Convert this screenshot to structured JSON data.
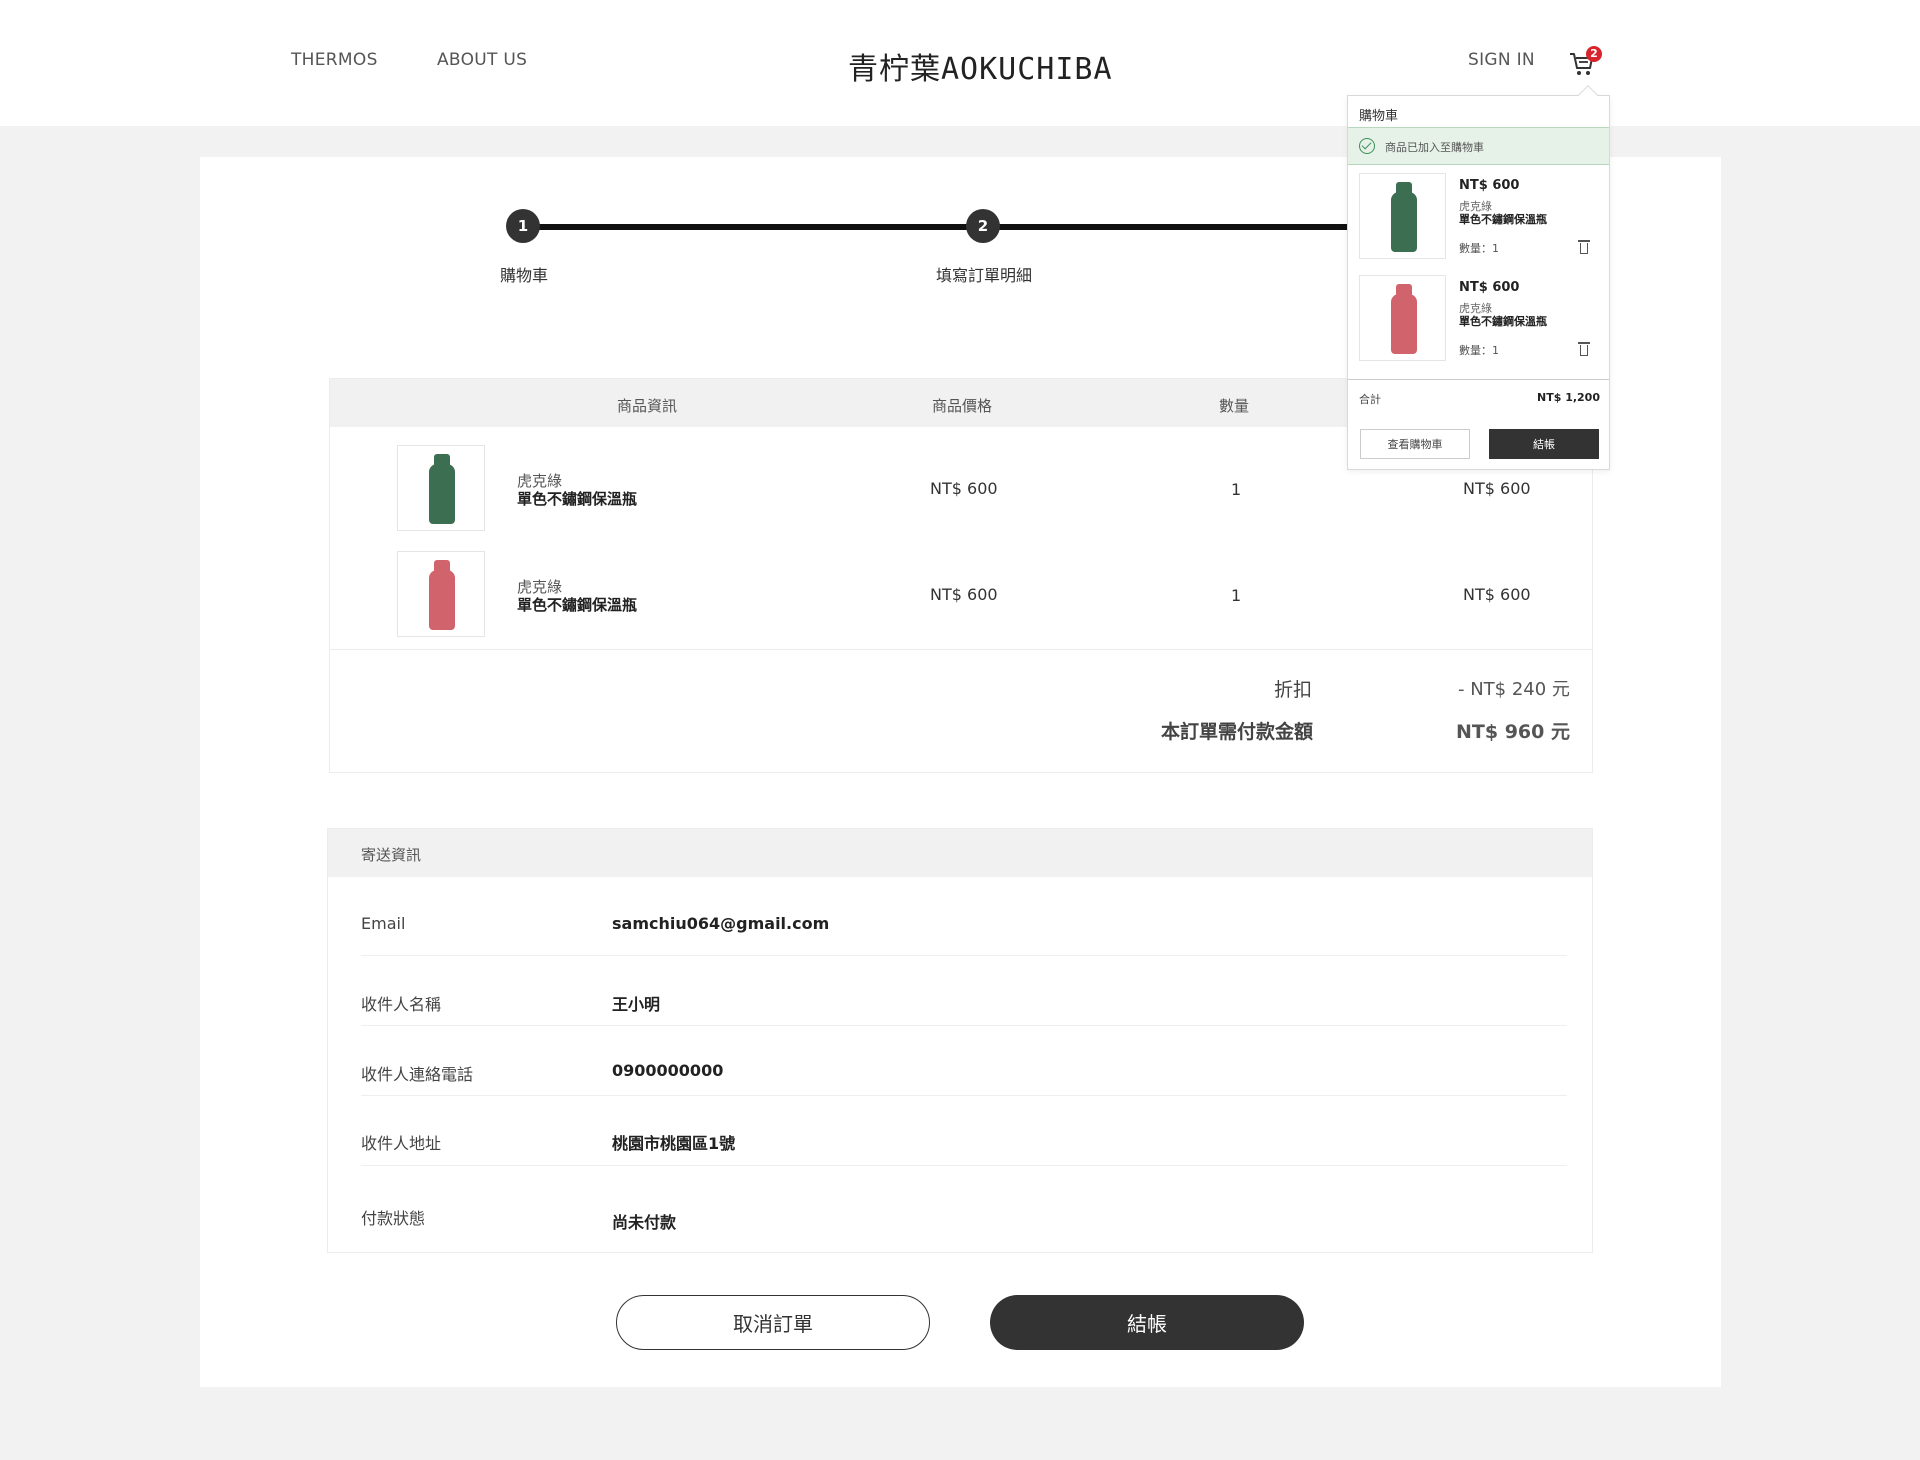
{
  "header": {
    "nav_left": [
      "THERMOS",
      "ABOUT US"
    ],
    "logo": "青柠葉AOKUCHIBA",
    "sign_in": "SIGN IN",
    "cart_count": "2"
  },
  "stepper": {
    "steps": [
      {
        "number": "1",
        "label": "購物車"
      },
      {
        "number": "2",
        "label": "填寫訂單明細"
      }
    ]
  },
  "order_table": {
    "headers": [
      "商品資訊",
      "商品價格",
      "數量"
    ],
    "items": [
      {
        "subtitle": "虎克綠",
        "name": "單色不鏽鋼保溫瓶",
        "price": "NT$ 600",
        "qty": "1",
        "subtotal": "NT$ 600",
        "color": "#3c6e51"
      },
      {
        "subtitle": "虎克綠",
        "name": "單色不鏽鋼保溫瓶",
        "price": "NT$ 600",
        "qty": "1",
        "subtotal": "NT$ 600",
        "color": "#d1636c"
      }
    ],
    "discount_label": "折扣",
    "discount_value": "- NT$  240 元",
    "total_label": "本訂單需付款金額",
    "total_value": "NT$  960 元"
  },
  "shipping": {
    "title": "寄送資訊",
    "rows": [
      {
        "label": "Email",
        "value": "samchiu064@gmail.com"
      },
      {
        "label": "收件人名稱",
        "value": "王小明"
      },
      {
        "label": "收件人連絡電話",
        "value": "0900000000"
      },
      {
        "label": "收件人地址",
        "value": "桃園市桃園區1號"
      },
      {
        "label": "付款狀態",
        "value": "尚未付款"
      }
    ]
  },
  "buttons": {
    "cancel": "取消訂單",
    "checkout": "結帳"
  },
  "cart_dropdown": {
    "title": "購物車",
    "success_message": "商品已加入至購物車",
    "items": [
      {
        "price": "NT$ 600",
        "subtitle": "虎克綠",
        "name": "單色不鏽鋼保溫瓶",
        "qty": "數量：1"
      },
      {
        "price": "NT$ 600",
        "subtitle": "虎克綠",
        "name": "單色不鏽鋼保溫瓶",
        "qty": "數量：1"
      }
    ],
    "total_label": "合計",
    "total_value": "NT$ 1,200",
    "view_cart": "查看購物車",
    "checkout": "結帳"
  }
}
